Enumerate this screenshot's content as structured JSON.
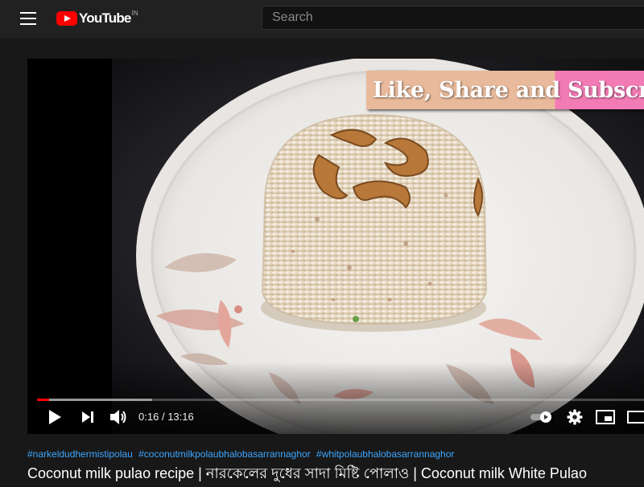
{
  "header": {
    "logo_text": "YouTube",
    "logo_country": "IN",
    "search_placeholder": "Search"
  },
  "player": {
    "overlay_text": "Like, Share and Subscribe",
    "current_time": "0:16",
    "separator": "/",
    "duration": "13:16",
    "played_fraction": 0.02,
    "buffered_fraction": 0.19,
    "autoplay_on": true
  },
  "video": {
    "hashtags": [
      "#narkeldudhermistipolau",
      "#coconutmilkpolaubhalobasarrannaghor",
      "#whitpolaubhalobasarrannaghor"
    ],
    "title": "Coconut milk pulao recipe | নারকেলের দুধের সাদা মিষ্টি পোলাও | Coconut milk White Pulao"
  },
  "colors": {
    "accent": "#ff0000",
    "link": "#3ea6ff",
    "topbar": "#212121",
    "background": "#181818"
  },
  "icons": [
    "menu-icon",
    "youtube-logo-icon",
    "play-icon",
    "next-icon",
    "volume-icon",
    "autoplay-toggle-icon",
    "settings-gear-icon",
    "miniplayer-icon",
    "theater-icon"
  ]
}
